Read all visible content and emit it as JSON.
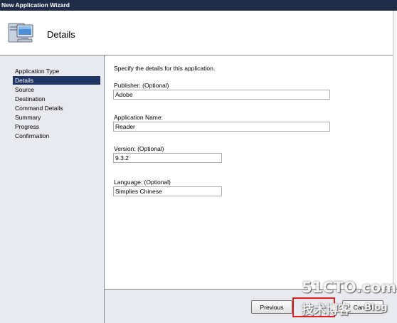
{
  "window": {
    "title": "New Application Wizard"
  },
  "header": {
    "title": "Details",
    "icon": "computer-icon"
  },
  "nav": {
    "items": [
      {
        "label": "Application Type",
        "active": false
      },
      {
        "label": "Details",
        "active": true
      },
      {
        "label": "Source",
        "active": false
      },
      {
        "label": "Destination",
        "active": false
      },
      {
        "label": "Command Details",
        "active": false
      },
      {
        "label": "Summary",
        "active": false
      },
      {
        "label": "Progress",
        "active": false
      },
      {
        "label": "Confirmation",
        "active": false
      }
    ]
  },
  "main": {
    "instruction": "Specify the details for this application.",
    "publisher": {
      "label": "Publisher: (Optional)",
      "value": "Adobe"
    },
    "app_name": {
      "label": "Application Name:",
      "value": "Reader"
    },
    "version": {
      "label": "Version: (Optional)",
      "value": "9.3.2"
    },
    "language": {
      "label": "Language: (Optional)",
      "value": "Simplies Chinese"
    }
  },
  "footer": {
    "previous_label": "Previous",
    "cancel_label": "Cancel"
  },
  "watermark": {
    "line1": "51CTO.com",
    "line2": "技术博客",
    "line3": "Blog"
  },
  "colors": {
    "titlebar": "#1e2c48",
    "nav_active": "#1f3566",
    "highlight": "#e02020"
  }
}
